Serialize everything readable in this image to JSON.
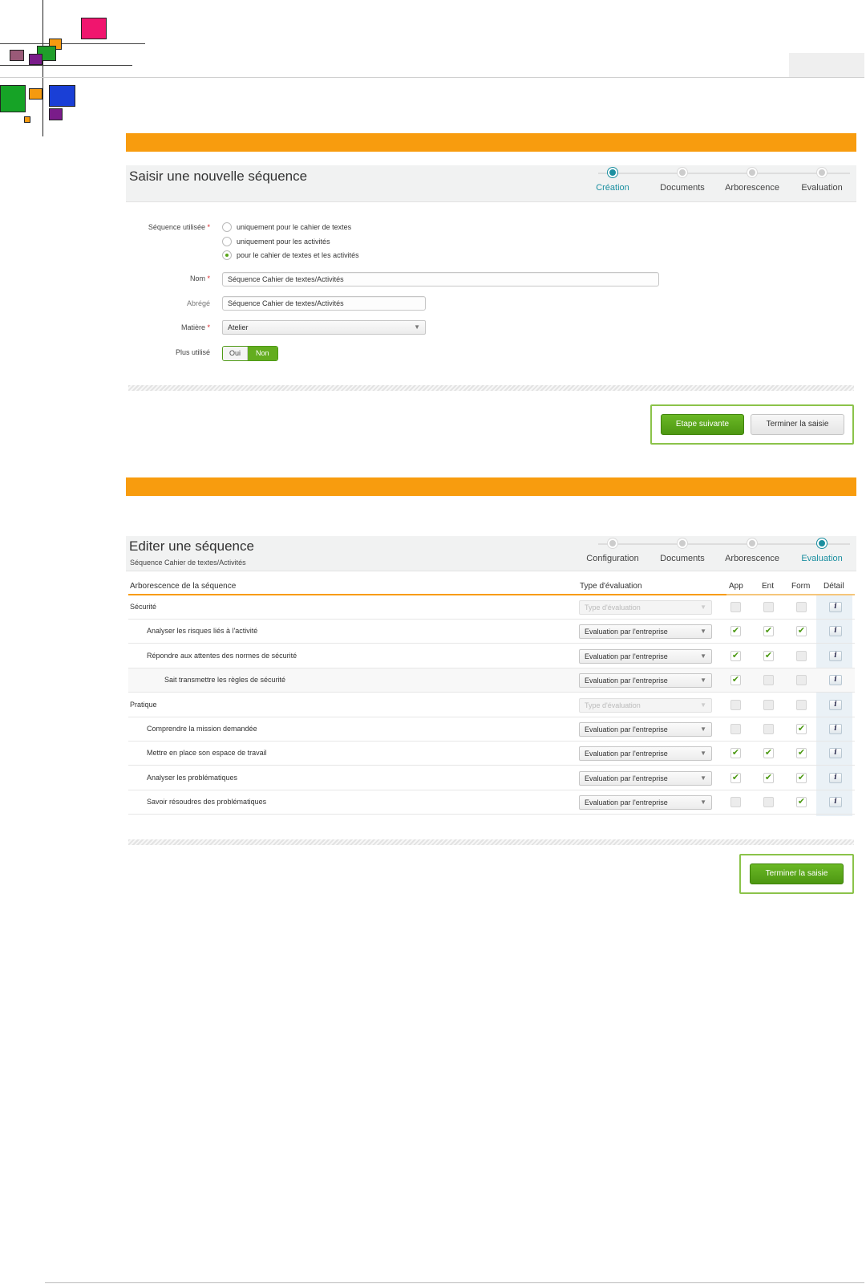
{
  "creation_panel": {
    "title": "Saisir une nouvelle séquence",
    "steps": [
      {
        "label": "Création",
        "active": true
      },
      {
        "label": "Documents",
        "active": false
      },
      {
        "label": "Arborescence",
        "active": false
      },
      {
        "label": "Evaluation",
        "active": false
      }
    ],
    "form": {
      "usage_label": "Séquence utilisée",
      "usage_options": [
        {
          "label": "uniquement pour le cahier de textes",
          "selected": false
        },
        {
          "label": "uniquement pour les activités",
          "selected": false
        },
        {
          "label": "pour le cahier de textes et les activités",
          "selected": true
        }
      ],
      "name_label": "Nom",
      "name_value": "Séquence Cahier de textes/Activités",
      "short_label": "Abrégé",
      "short_value": "Séquence Cahier de textes/Activités",
      "subject_label": "Matière",
      "subject_value": "Atelier",
      "unused_label": "Plus utilisé",
      "toggle_yes": "Oui",
      "toggle_no": "Non",
      "toggle_selected": "Non",
      "required_mark": "*"
    },
    "next_button": "Etape suivante",
    "finish_button": "Terminer la saisie"
  },
  "edit_panel": {
    "title": "Editer une séquence",
    "subtitle": "Séquence Cahier de textes/Activités",
    "steps": [
      {
        "label": "Configuration",
        "active": false
      },
      {
        "label": "Documents",
        "active": false
      },
      {
        "label": "Arborescence",
        "active": false
      },
      {
        "label": "Evaluation",
        "active": true
      }
    ],
    "table": {
      "headers": {
        "tree": "Arborescence de la séquence",
        "type": "Type d'évaluation",
        "app": "App",
        "ent": "Ent",
        "form": "Form",
        "detail": "Détail"
      },
      "check_glyph": "✔",
      "info_glyph": "i",
      "rows": [
        {
          "name": "Sécurité",
          "level": 0,
          "type": "Type d'évaluation",
          "type_disabled": true,
          "app": false,
          "ent": false,
          "form": false
        },
        {
          "name": "Analyser les risques liés à l'activité",
          "level": 1,
          "type": "Evaluation par l'entreprise",
          "type_disabled": false,
          "app": true,
          "ent": true,
          "form": true
        },
        {
          "name": "Répondre aux attentes des normes de sécurité",
          "level": 1,
          "type": "Evaluation par l'entreprise",
          "type_disabled": false,
          "app": true,
          "ent": true,
          "form": false
        },
        {
          "name": "Sait transmettre les règles de sécurité",
          "level": 2,
          "type": "Evaluation par l'entreprise",
          "type_disabled": false,
          "app": true,
          "ent": false,
          "form": false
        },
        {
          "name": "Pratique",
          "level": 0,
          "type": "Type d'évaluation",
          "type_disabled": true,
          "app": false,
          "ent": false,
          "form": false
        },
        {
          "name": "Comprendre la mission demandée",
          "level": 1,
          "type": "Evaluation par l'entreprise",
          "type_disabled": false,
          "app": false,
          "ent": false,
          "form": true
        },
        {
          "name": "Mettre en place son espace de travail",
          "level": 1,
          "type": "Evaluation par l'entreprise",
          "type_disabled": false,
          "app": true,
          "ent": true,
          "form": true
        },
        {
          "name": "Analyser les problématiques",
          "level": 1,
          "type": "Evaluation par l'entreprise",
          "type_disabled": false,
          "app": true,
          "ent": true,
          "form": true
        },
        {
          "name": "Savoir résoudres des problématiques",
          "level": 1,
          "type": "Evaluation par l'entreprise",
          "type_disabled": false,
          "app": false,
          "ent": false,
          "form": true
        }
      ]
    },
    "finish_button": "Terminer la saisie"
  },
  "colors": {
    "orange_bar": "#f89c0e",
    "accent_teal": "#1b8fa0",
    "button_green": "#5aa51a",
    "highlight_border": "#8bc34a"
  }
}
